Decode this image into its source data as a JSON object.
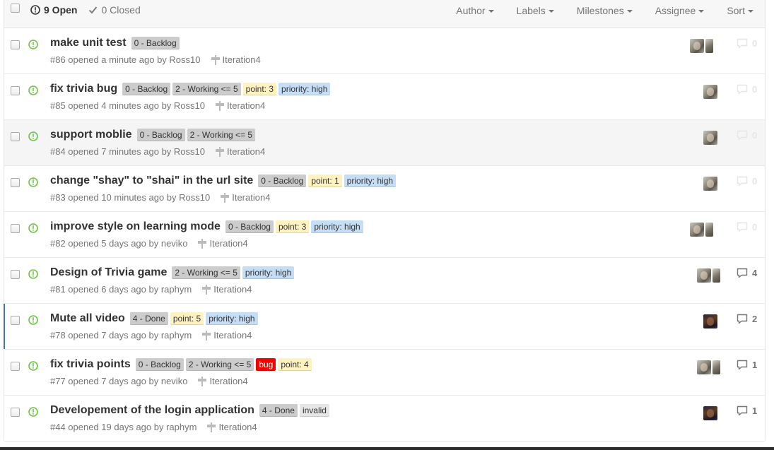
{
  "header": {
    "open_label": "9 Open",
    "closed_label": "0 Closed",
    "filters": [
      "Author",
      "Labels",
      "Milestones",
      "Assignee",
      "Sort"
    ]
  },
  "issues": [
    {
      "title": "make unit test",
      "meta": "#86 opened a minute ago by Ross10",
      "milestone": "Iteration4",
      "labels": [
        {
          "text": "0 - Backlog",
          "bg": "#cccccc",
          "fg": "#333333"
        }
      ],
      "avatars": 2,
      "comments": "0"
    },
    {
      "title": "fix trivia bug",
      "meta": "#85 opened 4 minutes ago by Ross10",
      "milestone": "Iteration4",
      "labels": [
        {
          "text": "0 - Backlog",
          "bg": "#cccccc",
          "fg": "#333333"
        },
        {
          "text": "2 - Working <= 5",
          "bg": "#cccccc",
          "fg": "#333333"
        },
        {
          "text": "point: 3",
          "bg": "#fef2c0",
          "fg": "#333333"
        },
        {
          "text": "priority: high",
          "bg": "#c5def5",
          "fg": "#333333"
        }
      ],
      "avatars": 1,
      "comments": "0"
    },
    {
      "title": "support moblie",
      "meta": "#84 opened 7 minutes ago by Ross10",
      "milestone": "Iteration4",
      "labels": [
        {
          "text": "0 - Backlog",
          "bg": "#cccccc",
          "fg": "#333333"
        },
        {
          "text": "2 - Working <= 5",
          "bg": "#cccccc",
          "fg": "#333333"
        }
      ],
      "avatars": 1,
      "comments": "0"
    },
    {
      "title": "change \"shay\" to \"shai\" in the url site",
      "meta": "#83 opened 10 minutes ago by Ross10",
      "milestone": "Iteration4",
      "labels": [
        {
          "text": "0 - Backlog",
          "bg": "#cccccc",
          "fg": "#333333"
        },
        {
          "text": "point: 1",
          "bg": "#fef2c0",
          "fg": "#333333"
        },
        {
          "text": "priority: high",
          "bg": "#c5def5",
          "fg": "#333333"
        }
      ],
      "avatars": 1,
      "comments": "0"
    },
    {
      "title": "improve style on learning mode",
      "meta": "#82 opened 5 days ago by neviko",
      "milestone": "Iteration4",
      "labels": [
        {
          "text": "0 - Backlog",
          "bg": "#cccccc",
          "fg": "#333333"
        },
        {
          "text": "point: 3",
          "bg": "#fef2c0",
          "fg": "#333333"
        },
        {
          "text": "priority: high",
          "bg": "#c5def5",
          "fg": "#333333"
        }
      ],
      "avatars": 2,
      "comments": "0"
    },
    {
      "title": "Design of Trivia game",
      "meta": "#81 opened 6 days ago by raphym",
      "milestone": "Iteration4",
      "labels": [
        {
          "text": "2 - Working <= 5",
          "bg": "#cccccc",
          "fg": "#333333"
        },
        {
          "text": "priority: high",
          "bg": "#c5def5",
          "fg": "#333333"
        }
      ],
      "avatars": 2,
      "comments": "4"
    },
    {
      "title": "Mute all video",
      "meta": "#78 opened 7 days ago by raphym",
      "milestone": "Iteration4",
      "labels": [
        {
          "text": "4 - Done",
          "bg": "#cccccc",
          "fg": "#333333"
        },
        {
          "text": "point: 5",
          "bg": "#fef2c0",
          "fg": "#333333"
        },
        {
          "text": "priority: high",
          "bg": "#c5def5",
          "fg": "#333333"
        }
      ],
      "avatars": 1,
      "comments": "2"
    },
    {
      "title": "fix trivia points",
      "meta": "#77 opened 7 days ago by neviko",
      "milestone": "Iteration4",
      "labels": [
        {
          "text": "0 - Backlog",
          "bg": "#cccccc",
          "fg": "#333333"
        },
        {
          "text": "2 - Working <= 5",
          "bg": "#cccccc",
          "fg": "#333333"
        },
        {
          "text": "bug",
          "bg": "#ee0701",
          "fg": "#ffffff"
        },
        {
          "text": "point: 4",
          "bg": "#fef2c0",
          "fg": "#333333"
        }
      ],
      "avatars": 2,
      "comments": "1"
    },
    {
      "title": "Developement of the login application",
      "meta": "#44 opened 19 days ago by raphym",
      "milestone": "Iteration4",
      "labels": [
        {
          "text": "4 - Done",
          "bg": "#cccccc",
          "fg": "#333333"
        },
        {
          "text": "invalid",
          "bg": "#e6e6e6",
          "fg": "#333333"
        }
      ],
      "avatars": 1,
      "comments": "1"
    }
  ]
}
